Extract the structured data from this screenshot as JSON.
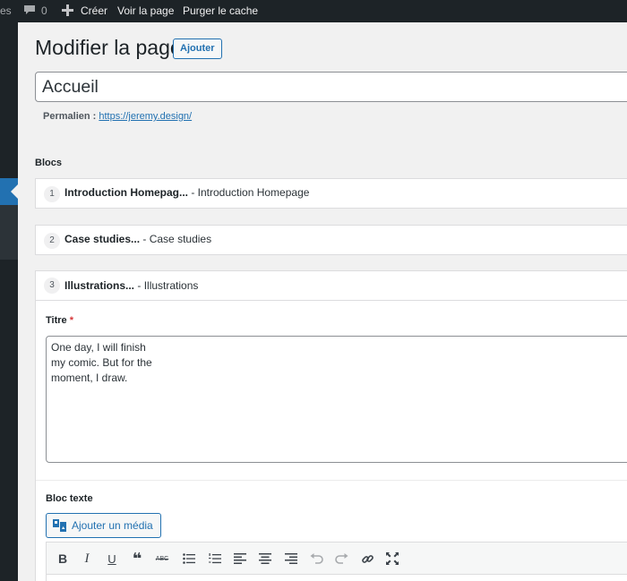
{
  "adminbar": {
    "left_fragment": "es",
    "comments_count": "0",
    "new_label": "Créer",
    "view_label": "Voir la page",
    "purge_label": "Purger le cache"
  },
  "heading": {
    "title": "Modifier la page",
    "add_label": "Ajouter"
  },
  "post": {
    "title_value": "Accueil",
    "permalink_label": "Permalien :",
    "permalink_url": "https://jeremy.design/"
  },
  "blocks": {
    "section_label": "Blocs",
    "items": [
      {
        "index": "1",
        "name": "Introduction Homepag...",
        "type": "- Introduction Homepage"
      },
      {
        "index": "2",
        "name": "Case studies...",
        "type": "- Case studies"
      },
      {
        "index": "3",
        "name": "Illustrations...",
        "type": "- Illustrations"
      }
    ]
  },
  "expanded_block": {
    "title_label": "Titre",
    "required_mark": "*",
    "title_value": "One day, I will finish\nmy comic. But for the\nmoment, I draw.",
    "text_label": "Bloc texte",
    "media_button": "Ajouter un média"
  },
  "toolbar": {
    "icons": [
      "bold-icon",
      "italic-icon",
      "underline-icon",
      "blockquote-icon",
      "strikethrough-icon",
      "bullet-list-icon",
      "numbered-list-icon",
      "align-left-icon",
      "align-center-icon",
      "align-right-icon",
      "undo-icon",
      "redo-icon",
      "link-icon",
      "fullscreen-icon"
    ],
    "bold": "B",
    "italic": "I",
    "underline": "U",
    "quote": "❝",
    "strike": "ABC"
  },
  "colors": {
    "adminbar_bg": "#1d2327",
    "accent": "#2271b1",
    "required": "#d63638"
  }
}
